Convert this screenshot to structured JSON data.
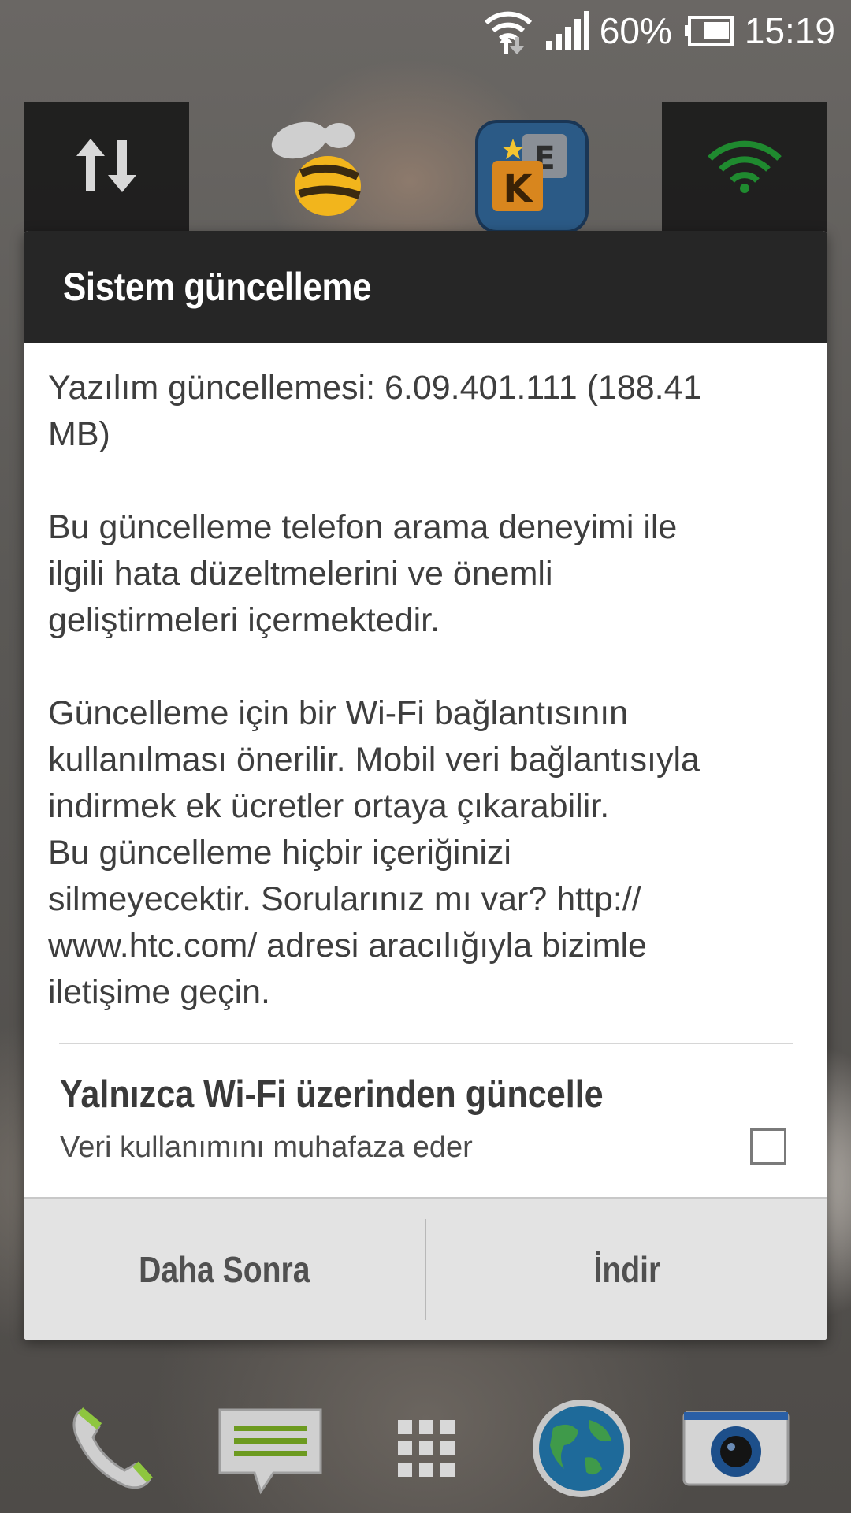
{
  "status_bar": {
    "battery": "60%",
    "time": "15:19",
    "icons": [
      "wifi-transfer-icon",
      "signal-icon",
      "battery-icon"
    ]
  },
  "home_row": {
    "icons": [
      "data-toggle-icon",
      "swarm-bee-app-icon",
      "wordfeud-app-icon",
      "wifi-toggle-icon"
    ]
  },
  "dialog": {
    "title": "Sistem güncelleme",
    "version_line": "Yazılım güncellemesi: 6.09.401.111 (188.41\nMB)",
    "description": "Bu güncelleme telefon arama deneyimi ile\nilgili hata düzeltmelerini ve önemli\ngeliştirmeleri içermektedir.",
    "notice": "Güncelleme için bir Wi-Fi bağlantısının\nkullanılması önerilir. Mobil veri bağlantısıyla\nindirmek ek ücretler ortaya çıkarabilir.\nBu güncelleme hiçbir içeriğinizi\nsilmeyecektir. Sorularınız mı var? http://\nwww.htc.com/ adresi aracılığıyla bizimle\niletişime geçin.",
    "option": {
      "title": "Yalnızca Wi-Fi üzerinden güncelle",
      "subtitle": "Veri kullanımını muhafaza eder",
      "checked": false
    },
    "buttons": {
      "later": "Daha Sonra",
      "download": "İndir"
    }
  },
  "dock": {
    "icons": [
      "phone-icon",
      "messages-icon",
      "app-drawer-icon",
      "browser-globe-icon",
      "camera-icon"
    ]
  },
  "colors": {
    "dialog_header": "#262626",
    "button_bar": "#e3e3e3",
    "body_text": "#3e3e3e"
  }
}
